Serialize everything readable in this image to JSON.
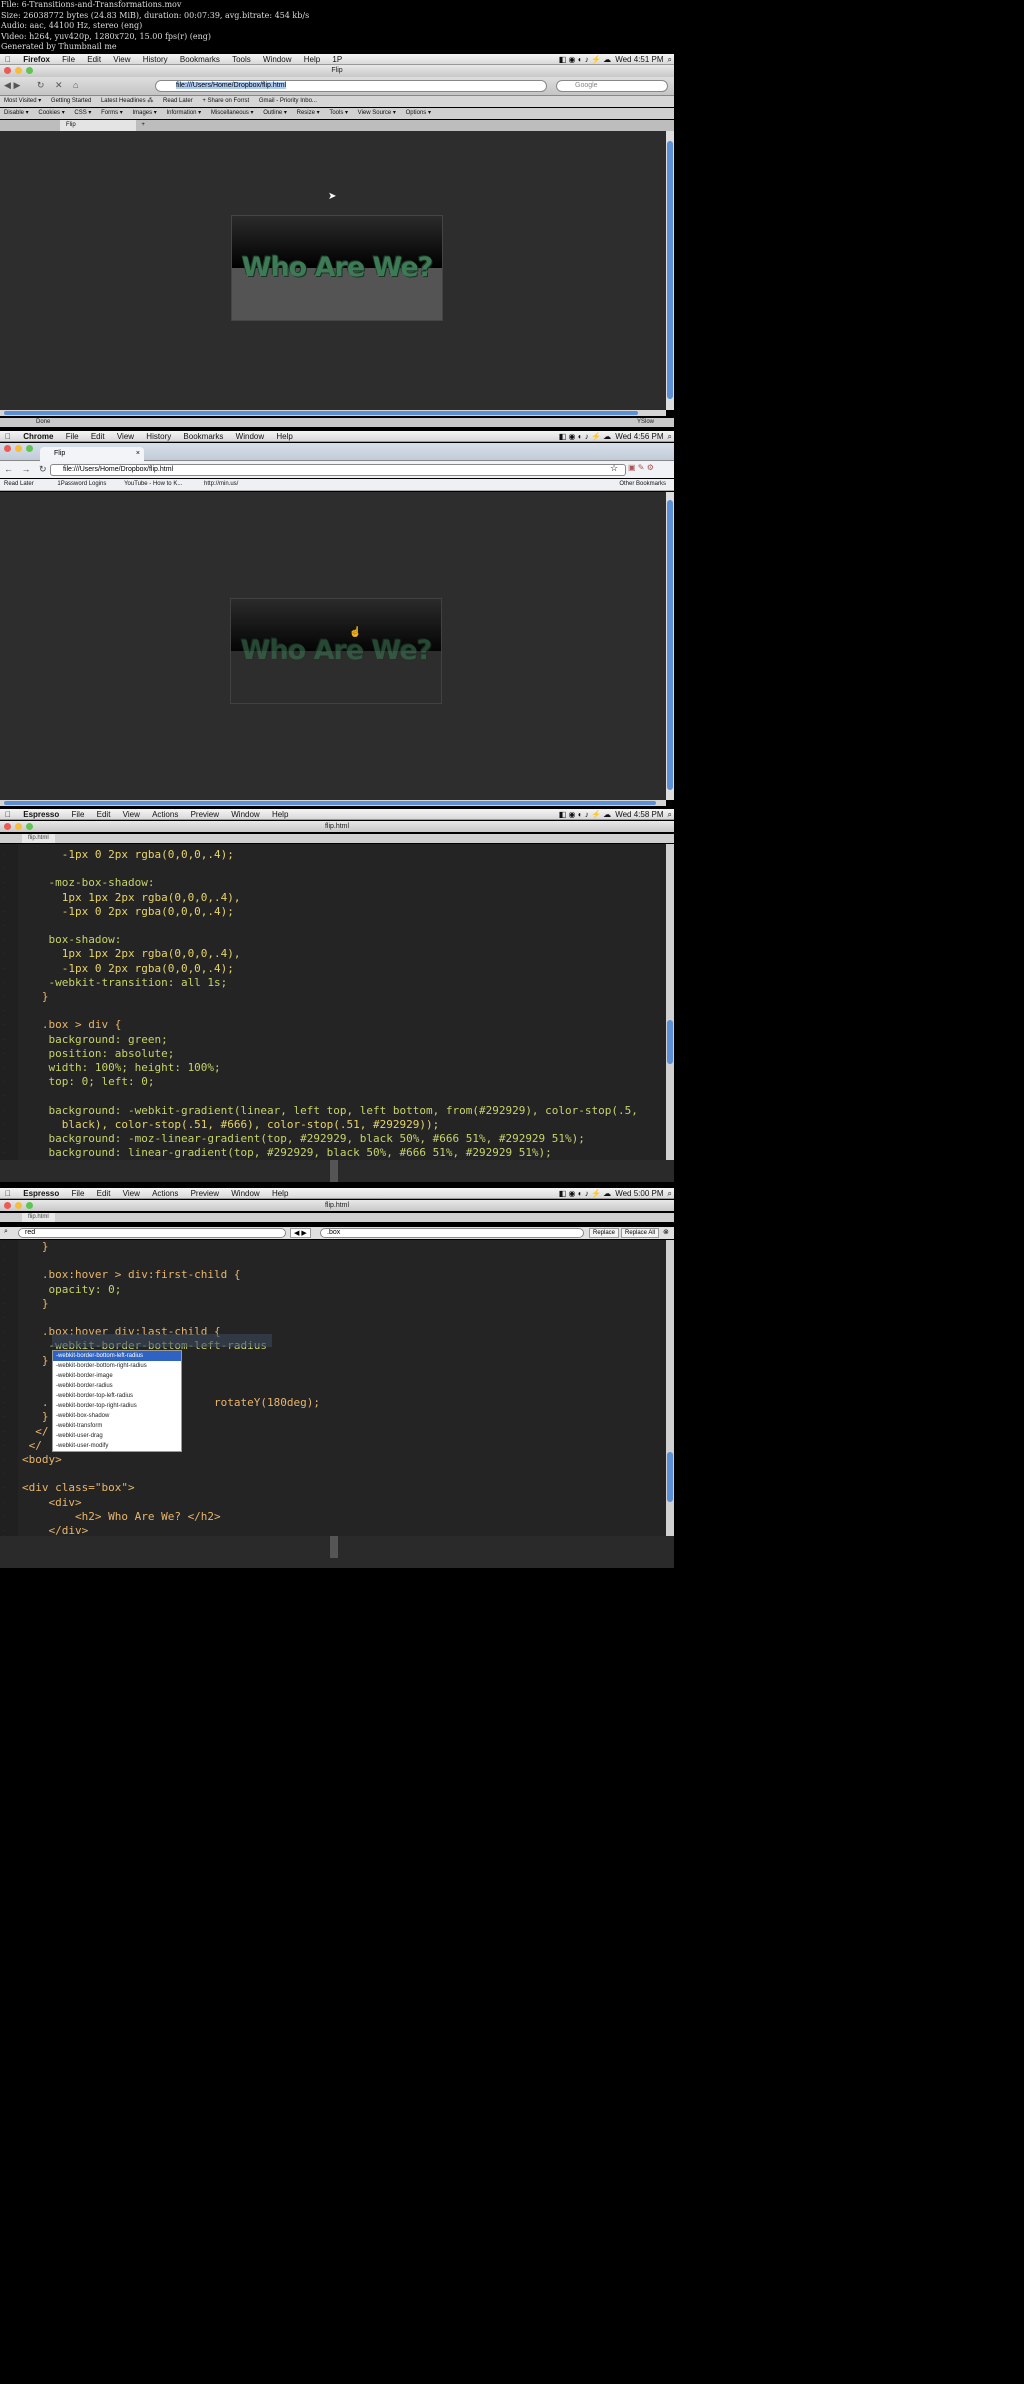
{
  "file_info": {
    "line1": "File: 6-Transitions-and-Transformations.mov",
    "line2": "Size: 26038772 bytes (24.83 MiB), duration: 00:07:39, avg.bitrate: 454 kb/s",
    "line3": "Audio: aac, 44100 Hz, stereo (eng)",
    "line4": "Video: h264, yuv420p, 1280x720, 15.00 fps(r) (eng)",
    "line5": "Generated by Thumbnail me"
  },
  "frame1": {
    "menu": {
      "app": "Firefox",
      "items": [
        "File",
        "Edit",
        "View",
        "History",
        "Bookmarks",
        "Tools",
        "Window",
        "Help",
        "1P"
      ],
      "clock": "Wed 4:51 PM"
    },
    "window_title": "Flip",
    "url": "file:///Users/Home/Dropbox/flip.html",
    "search_placeholder": "Google",
    "bookmarks": [
      "Most Visited ▾",
      "Getting Started",
      "Latest Headlines ⁂",
      "Read Later",
      "+ Share on Forrst",
      "Gmail - Priority Inbo..."
    ],
    "devbar": [
      "Disable ▾",
      "Cookies ▾",
      "CSS ▾",
      "Forms ▾",
      "Images ▾",
      "Information ▾",
      "Miscellaneous ▾",
      "Outline ▾",
      "Resize ▾",
      "Tools ▾",
      "View Source ▾",
      "Options ▾"
    ],
    "tab": "Flip",
    "heading": "Who Are We?",
    "status": "Done",
    "yslow": "YSlow"
  },
  "frame2": {
    "menu": {
      "app": "Chrome",
      "items": [
        "File",
        "Edit",
        "View",
        "History",
        "Bookmarks",
        "Window",
        "Help"
      ],
      "clock": "Wed 4:56 PM"
    },
    "tab": "Flip",
    "url": "file:///Users/Home/Dropbox/flip.html",
    "bookmarks": [
      "Read Later",
      "1Password Logins",
      "YouTube - How to K...",
      "http://min.us/"
    ],
    "other_bookmarks": "Other Bookmarks",
    "heading": "Who Are We?"
  },
  "frame3": {
    "menu": {
      "app": "Espresso",
      "items": [
        "File",
        "Edit",
        "View",
        "Actions",
        "Preview",
        "Window",
        "Help"
      ],
      "clock": "Wed 4:58 PM"
    },
    "window_title": "flip.html",
    "tab": "flip.html",
    "code": [
      "      -1px 0 2px rgba(0,0,0,.4);",
      "",
      "    -moz-box-shadow:",
      "      1px 1px 2px rgba(0,0,0,.4),",
      "      -1px 0 2px rgba(0,0,0,.4);",
      "",
      "    box-shadow:",
      "      1px 1px 2px rgba(0,0,0,.4),",
      "      -1px 0 2px rgba(0,0,0,.4);",
      "    -webkit-transition: all 1s;",
      "   }",
      "",
      "   .box > div {",
      "    background: green;",
      "    position: absolute;",
      "    width: 100%; height: 100%;",
      "    top: 0; left: 0;",
      "",
      "    background: -webkit-gradient(linear, left top, left bottom, from(#292929), color-stop(.5,",
      "      black), color-stop(.51, #666), color-stop(.51, #292929));",
      "    background: -moz-linear-gradient(top, #292929, black 50%, #666 51%, #292929 51%);",
      "    background: linear-gradient(top, #292929, black 50%, #666 51%, #292929 51%);"
    ]
  },
  "frame4": {
    "menu": {
      "app": "Espresso",
      "items": [
        "File",
        "Edit",
        "View",
        "Actions",
        "Preview",
        "Window",
        "Help"
      ],
      "clock": "Wed 5:00 PM"
    },
    "window_title": "flip.html",
    "tab": "flip.html",
    "find_value": "red",
    "replace_value": ".box",
    "replace_label": "Replace",
    "replace_all_label": "Replace All",
    "code": [
      "   }",
      "",
      "   .box:hover > div:first-child {",
      "    opacity: 0;",
      "   }",
      "",
      "   .box:hover div:last-child {",
      "    -webkit-border-bottom-left-radius",
      "   }",
      "",
      "",
      "   .                         rotateY(180deg);",
      "   }",
      "  </",
      " </",
      "<body>",
      "",
      "<div class=\"box\">",
      "    <div>",
      "        <h2> Who Are We? </h2>",
      "    </div>"
    ],
    "autocomplete": [
      "-webkit-border-bottom-left-radius",
      "-webkit-border-bottom-right-radius",
      "-webkit-border-image",
      "-webkit-border-radius",
      "-webkit-border-top-left-radius",
      "-webkit-border-top-right-radius",
      "-webkit-box-shadow",
      "-webkit-transform",
      "-webkit-user-drag",
      "-webkit-user-modify"
    ]
  }
}
